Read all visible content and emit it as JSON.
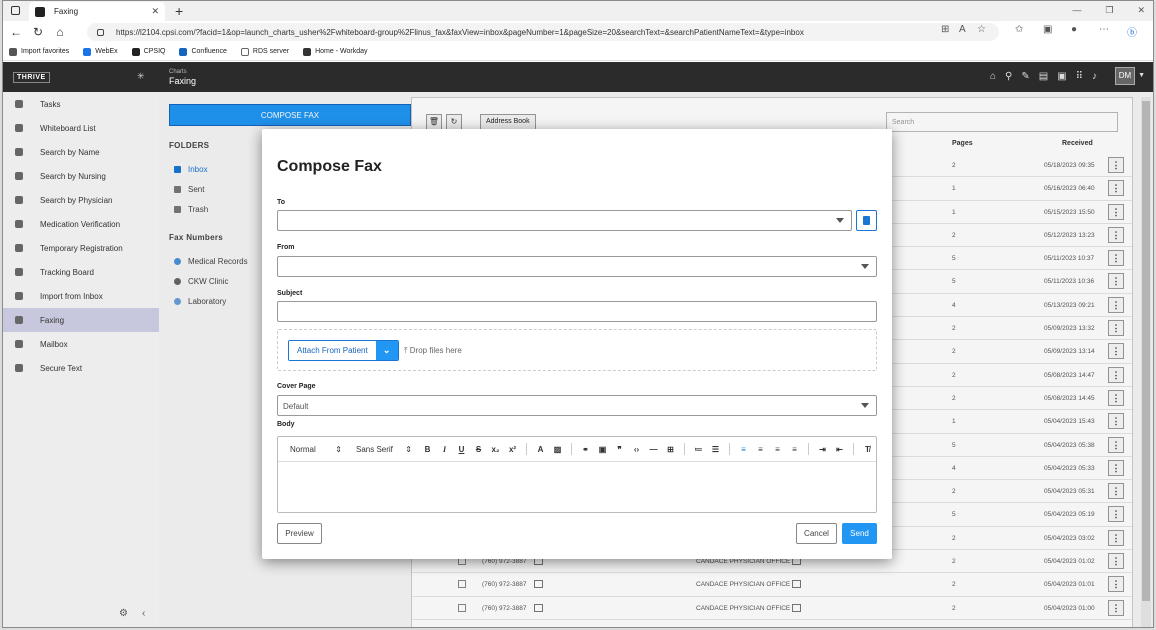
{
  "browser": {
    "tab_title": "Faxing",
    "url": "https://l2104.cpsi.com/?facid=1&op=launch_charts_usher%2Fwhiteboard-group%2Flinus_fax&faxView=inbox&pageNumber=1&pageSize=20&searchText=&searchPatientNameText=&type=inbox",
    "favorites": [
      "Import favorites",
      "WebEx",
      "CPSIQ",
      "Confluence",
      "RDS server",
      "Home - Workday"
    ]
  },
  "app": {
    "logo": "THRIVE",
    "title_sub": "Charts",
    "title_main": "Faxing",
    "user_initials": "DM"
  },
  "sidebar": {
    "items": [
      {
        "label": "Tasks"
      },
      {
        "label": "Whiteboard List"
      },
      {
        "label": "Search by Name"
      },
      {
        "label": "Search by Nursing"
      },
      {
        "label": "Search by Physician"
      },
      {
        "label": "Medication Verification"
      },
      {
        "label": "Temporary Registration"
      },
      {
        "label": "Tracking Board"
      },
      {
        "label": "Import from Inbox"
      },
      {
        "label": "Faxing"
      },
      {
        "label": "Mailbox"
      },
      {
        "label": "Secure Text"
      }
    ],
    "active": "Faxing"
  },
  "folders": {
    "compose_label": "COMPOSE FAX",
    "heading": "FOLDERS",
    "items": [
      "Inbox",
      "Sent",
      "Trash"
    ],
    "fax_numbers_heading": "Fax Numbers",
    "fax_numbers": [
      {
        "label": "Medical Records",
        "color": "#4a90d9"
      },
      {
        "label": "CKW Clinic",
        "color": "#666666"
      },
      {
        "label": "Laboratory",
        "color": "#6a9fd8"
      }
    ]
  },
  "list": {
    "address_book_label": "Address Book",
    "search_placeholder": "Search",
    "col_pages": "Pages",
    "col_received": "Received",
    "rows": [
      {
        "phone": "",
        "name": "",
        "pages": "2",
        "received": "05/18/2023 09:35"
      },
      {
        "phone": "",
        "name": "",
        "pages": "1",
        "received": "05/16/2023 06:40"
      },
      {
        "phone": "",
        "name": "",
        "pages": "1",
        "received": "05/15/2023 15:50"
      },
      {
        "phone": "",
        "name": "",
        "pages": "2",
        "received": "05/12/2023 13:23"
      },
      {
        "phone": "",
        "name": "",
        "pages": "5",
        "received": "05/11/2023 10:37"
      },
      {
        "phone": "",
        "name": "",
        "pages": "5",
        "received": "05/11/2023 10:36"
      },
      {
        "phone": "",
        "name": "",
        "pages": "4",
        "received": "05/13/2023 09:21"
      },
      {
        "phone": "",
        "name": "",
        "pages": "2",
        "received": "05/09/2023 13:32"
      },
      {
        "phone": "",
        "name": "",
        "pages": "2",
        "received": "05/09/2023 13:14"
      },
      {
        "phone": "",
        "name": "",
        "pages": "2",
        "received": "05/08/2023 14:47"
      },
      {
        "phone": "",
        "name": "",
        "pages": "2",
        "received": "05/08/2023 14:45"
      },
      {
        "phone": "",
        "name": "",
        "pages": "1",
        "received": "05/04/2023 15:43"
      },
      {
        "phone": "",
        "name": "",
        "pages": "5",
        "received": "05/04/2023 05:38"
      },
      {
        "phone": "",
        "name": "",
        "pages": "4",
        "received": "05/04/2023 05:33"
      },
      {
        "phone": "",
        "name": "",
        "pages": "2",
        "received": "05/04/2023 05:31"
      },
      {
        "phone": "",
        "name": "",
        "pages": "5",
        "received": "05/04/2023 05:19"
      },
      {
        "phone": "",
        "name": "",
        "pages": "2",
        "received": "05/04/2023 03:02"
      },
      {
        "phone": "(760) 972-3887",
        "name": "CANDACE PHYSICIAN OFFICE",
        "pages": "2",
        "received": "05/04/2023 01:02"
      },
      {
        "phone": "(760) 972-3887",
        "name": "CANDACE PHYSICIAN OFFICE",
        "pages": "2",
        "received": "05/04/2023 01:01"
      },
      {
        "phone": "(760) 972-3887",
        "name": "CANDACE PHYSICIAN OFFICE",
        "pages": "2",
        "received": "05/04/2023 01:00"
      }
    ]
  },
  "modal": {
    "title": "Compose Fax",
    "to_label": "To",
    "to_value": "",
    "from_label": "From",
    "from_value": "",
    "subject_label": "Subject",
    "subject_value": "",
    "attach_label": "Attach From Patient",
    "drop_label": "Drop files here",
    "cover_label": "Cover Page",
    "cover_value": "Default",
    "body_label": "Body",
    "editor_format": "Normal",
    "editor_font": "Sans Serif",
    "preview_label": "Preview",
    "cancel_label": "Cancel",
    "send_label": "Send"
  },
  "colors": {
    "accent": "#2196f3",
    "appbar": "#2b2b2b",
    "sidebar_active": "#c7c7dd"
  }
}
